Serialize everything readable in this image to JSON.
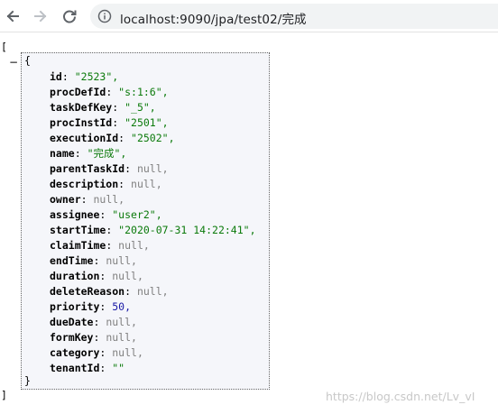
{
  "browser": {
    "url": "localhost:9090/jpa/test02/完成",
    "icons": [
      "back-arrow-icon",
      "forward-arrow-icon",
      "reload-icon",
      "info-icon"
    ]
  },
  "json_view": {
    "array_open": "[",
    "array_close": "]",
    "object_open": "{",
    "object_close": "}",
    "collapse_symbol": "−",
    "fields": [
      {
        "key": "id",
        "value": "\"2523\",",
        "kind": "str"
      },
      {
        "key": "procDefId",
        "value": "\"s:1:6\",",
        "kind": "str"
      },
      {
        "key": "taskDefKey",
        "value": "\"_5\",",
        "kind": "str"
      },
      {
        "key": "procInstId",
        "value": "\"2501\",",
        "kind": "str"
      },
      {
        "key": "executionId",
        "value": "\"2502\",",
        "kind": "str"
      },
      {
        "key": "name",
        "value": "\"完成\",",
        "kind": "str"
      },
      {
        "key": "parentTaskId",
        "value": "null,",
        "kind": "null"
      },
      {
        "key": "description",
        "value": "null,",
        "kind": "null"
      },
      {
        "key": "owner",
        "value": "null,",
        "kind": "null"
      },
      {
        "key": "assignee",
        "value": "\"user2\",",
        "kind": "str"
      },
      {
        "key": "startTime",
        "value": "\"2020-07-31 14:22:41\",",
        "kind": "str"
      },
      {
        "key": "claimTime",
        "value": "null,",
        "kind": "null"
      },
      {
        "key": "endTime",
        "value": "null,",
        "kind": "null"
      },
      {
        "key": "duration",
        "value": "null,",
        "kind": "null"
      },
      {
        "key": "deleteReason",
        "value": "null,",
        "kind": "null"
      },
      {
        "key": "priority",
        "value": "50,",
        "kind": "num"
      },
      {
        "key": "dueDate",
        "value": "null,",
        "kind": "null"
      },
      {
        "key": "formKey",
        "value": "null,",
        "kind": "null"
      },
      {
        "key": "category",
        "value": "null,",
        "kind": "null"
      },
      {
        "key": "tenantId",
        "value": "\"\"",
        "kind": "str"
      }
    ]
  },
  "watermark": "https://blog.csdn.net/Lv_vI",
  "colors": {
    "string": "#0b7a0b",
    "number": "#1a1aa6",
    "null": "#808080",
    "box_background": "#f5f6fa"
  }
}
